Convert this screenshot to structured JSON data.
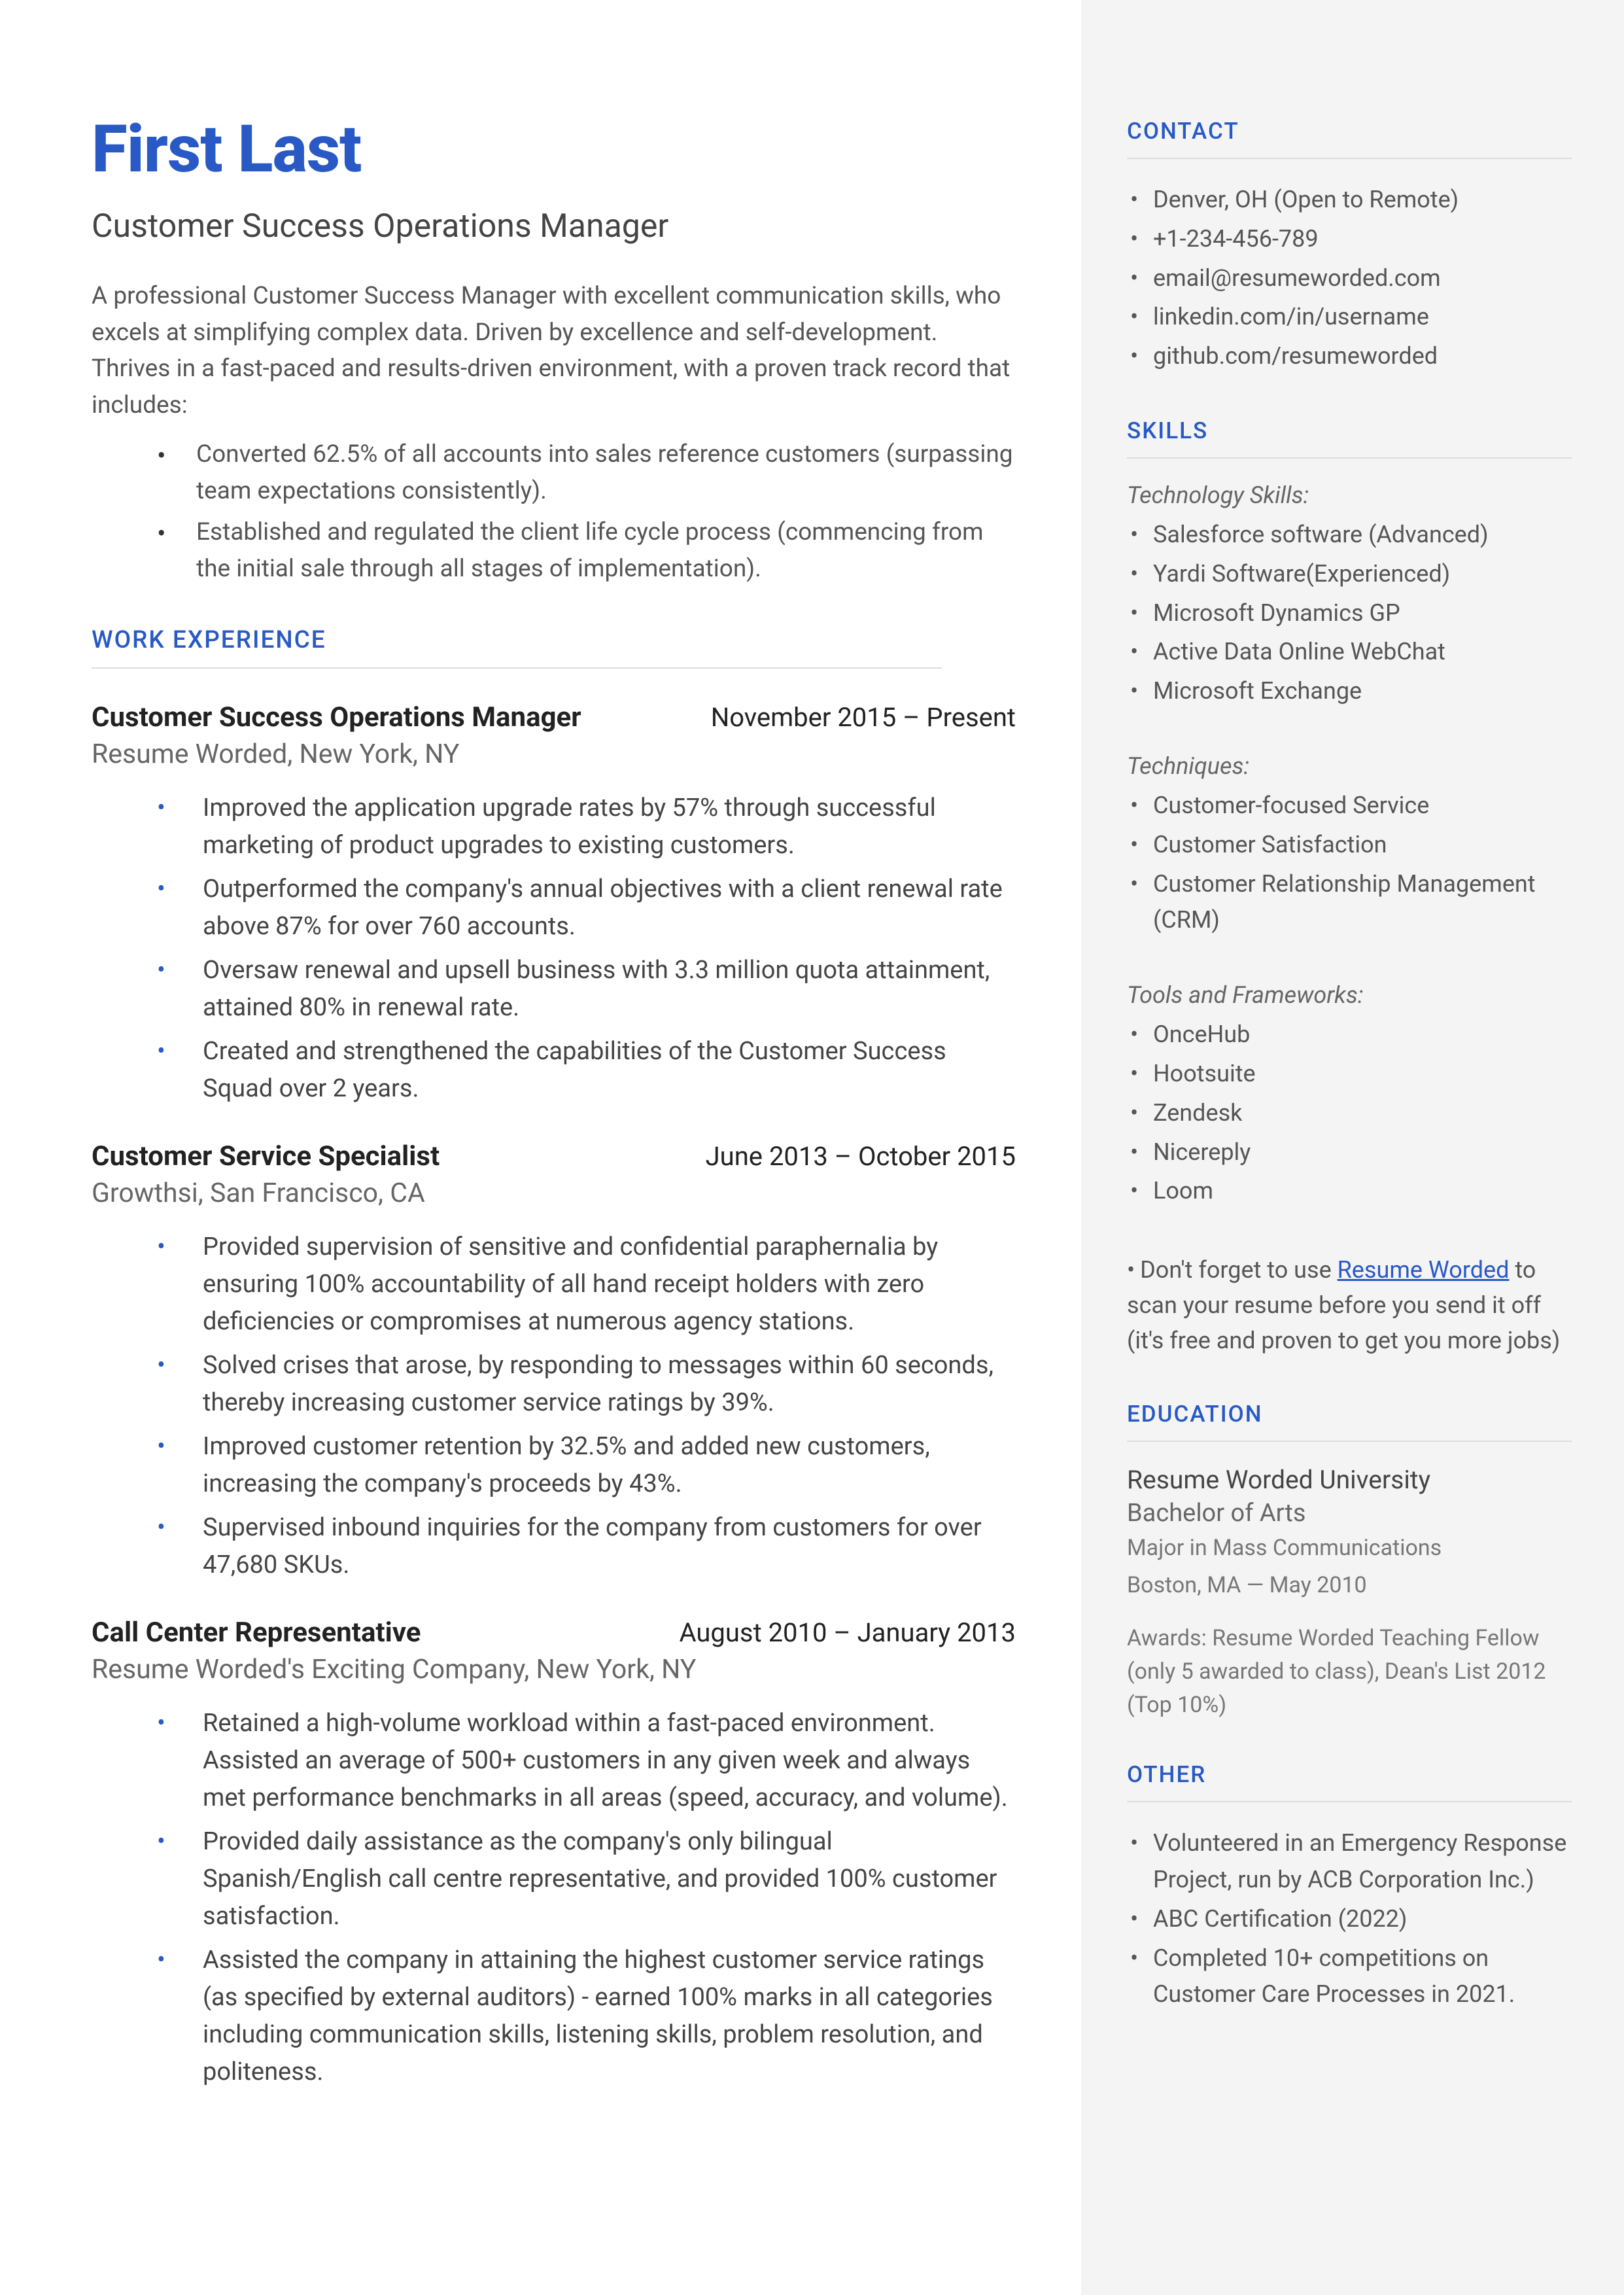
{
  "header": {
    "name": "First Last",
    "title": "Customer Success Operations Manager",
    "summary": "A professional Customer Success Manager with excellent communication skills, who excels at simplifying complex data. Driven by excellence and self-development. Thrives in a fast-paced and results-driven environment, with a proven track record that includes:",
    "summary_bullets": [
      "Converted 62.5% of all accounts into sales reference customers (surpassing team expectations consistently).",
      "Established and regulated the client life cycle process (commencing from the initial sale through all stages of implementation)."
    ]
  },
  "work_heading": "WORK EXPERIENCE",
  "jobs": [
    {
      "role": "Customer Success Operations Manager",
      "dates": "November 2015 – Present",
      "company": "Resume Worded, New York, NY",
      "bullets": [
        "Improved the application upgrade rates by 57% through successful marketing of product upgrades to existing customers.",
        "Outperformed the company's annual objectives with a client renewal rate above 87% for over 760 accounts.",
        "Oversaw renewal and upsell business with 3.3 million quota attainment, attained 80% in renewal rate.",
        "Created and strengthened the capabilities of the Customer Success Squad over 2 years."
      ]
    },
    {
      "role": "Customer Service Specialist",
      "dates": "June 2013 – October 2015",
      "company": "Growthsi, San Francisco, CA",
      "bullets": [
        "Provided supervision of sensitive and confidential paraphernalia by ensuring 100% accountability of all hand receipt holders with zero deficiencies or compromises at numerous agency stations.",
        "Solved crises that arose, by responding to messages within 60 seconds, thereby increasing customer service ratings by 39%.",
        "Improved customer retention by 32.5% and added new customers, increasing the company's proceeds by 43%.",
        "Supervised inbound inquiries for the company from customers for over 47,680 SKUs."
      ]
    },
    {
      "role": "Call Center Representative",
      "dates": "August 2010 – January 2013",
      "company": "Resume Worded's Exciting Company, New York, NY",
      "bullets": [
        "Retained a high-volume workload within a fast-paced environment. Assisted an average of 500+ customers in any given week and always met performance benchmarks in all areas (speed, accuracy, and volume).",
        "Provided daily assistance as the company's only bilingual Spanish/English call centre representative, and provided 100% customer satisfaction.",
        "Assisted the company in attaining the highest customer service ratings (as specified by external auditors) - earned 100% marks in all categories including communication skills, listening skills, problem resolution, and politeness."
      ]
    }
  ],
  "contact": {
    "heading": "CONTACT",
    "items": [
      "Denver, OH (Open to Remote)",
      "+1-234-456-789",
      "email@resumeworded.com",
      "linkedin.com/in/username",
      "github.com/resumeworded"
    ]
  },
  "skills": {
    "heading": "SKILLS",
    "groups": [
      {
        "title": "Technology Skills:",
        "items": [
          "Salesforce software  (Advanced)",
          "Yardi Software(Experienced)",
          "Microsoft Dynamics GP",
          "Active Data Online WebChat",
          "Microsoft Exchange"
        ]
      },
      {
        "title": "Techniques:",
        "items": [
          "Customer-focused Service",
          "Customer Satisfaction",
          "Customer Relationship Management (CRM)"
        ]
      },
      {
        "title": "Tools and Frameworks:",
        "items": [
          "OnceHub",
          "Hootsuite",
          "Zendesk",
          "Nicereply",
          "Loom"
        ]
      }
    ],
    "note_prefix": "Don't forget to use ",
    "note_link": "Resume Worded",
    "note_suffix": " to scan your resume before you send it off (it's free and proven to get you more jobs)"
  },
  "education": {
    "heading": "EDUCATION",
    "school": "Resume Worded University",
    "degree": "Bachelor of Arts",
    "major": "Major in Mass Communications",
    "location": "Boston, MA — May 2010",
    "awards": "Awards: Resume Worded Teaching Fellow (only 5 awarded to class), Dean's List 2012 (Top 10%)"
  },
  "other": {
    "heading": "OTHER",
    "items": [
      "Volunteered in an Emergency Response Project, run by ACB Corporation Inc.)",
      "ABC Certification (2022)",
      "Completed 10+ competitions on Customer Care  Processes in 2021."
    ]
  }
}
